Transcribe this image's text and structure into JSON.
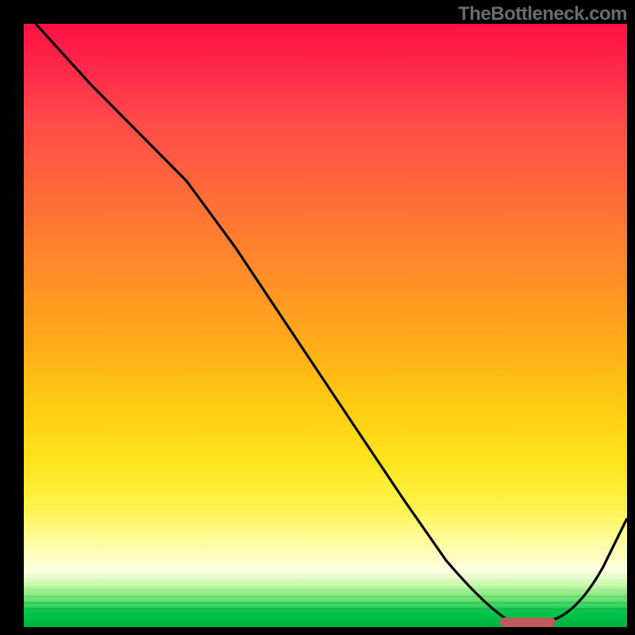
{
  "attribution": "TheBottleneck.com",
  "colors": {
    "gradient_top": "#ff1144",
    "gradient_mid": "#ffe31a",
    "gradient_bottom": "#00b040",
    "curve_stroke": "#000000",
    "marker_fill": "#c05a5a",
    "frame": "#000000",
    "attribution_text": "#6b6b6b"
  },
  "chart_data": {
    "type": "line",
    "title": "",
    "xlabel": "",
    "ylabel": "",
    "xlim": [
      0,
      100
    ],
    "ylim": [
      0,
      100
    ],
    "grid": false,
    "legend": false,
    "curve_points_xy": [
      [
        2,
        100
      ],
      [
        11,
        90
      ],
      [
        22,
        79
      ],
      [
        27,
        74
      ],
      [
        35,
        63
      ],
      [
        45,
        48
      ],
      [
        55,
        33
      ],
      [
        63,
        21
      ],
      [
        70,
        11
      ],
      [
        76,
        4
      ],
      [
        80,
        1
      ],
      [
        85,
        0.5
      ],
      [
        88,
        1
      ],
      [
        92,
        5
      ],
      [
        96,
        11
      ],
      [
        100,
        18
      ]
    ],
    "minimum_marker": {
      "x_start": 79,
      "x_end": 88,
      "y": 0.8
    },
    "notes": "Curve descends from upper-left to a minimum near x≈84 then rises toward the right edge. Y-axis reads as percentage-like (0 bottom, 100 top). Axes are unlabeled in the image."
  }
}
